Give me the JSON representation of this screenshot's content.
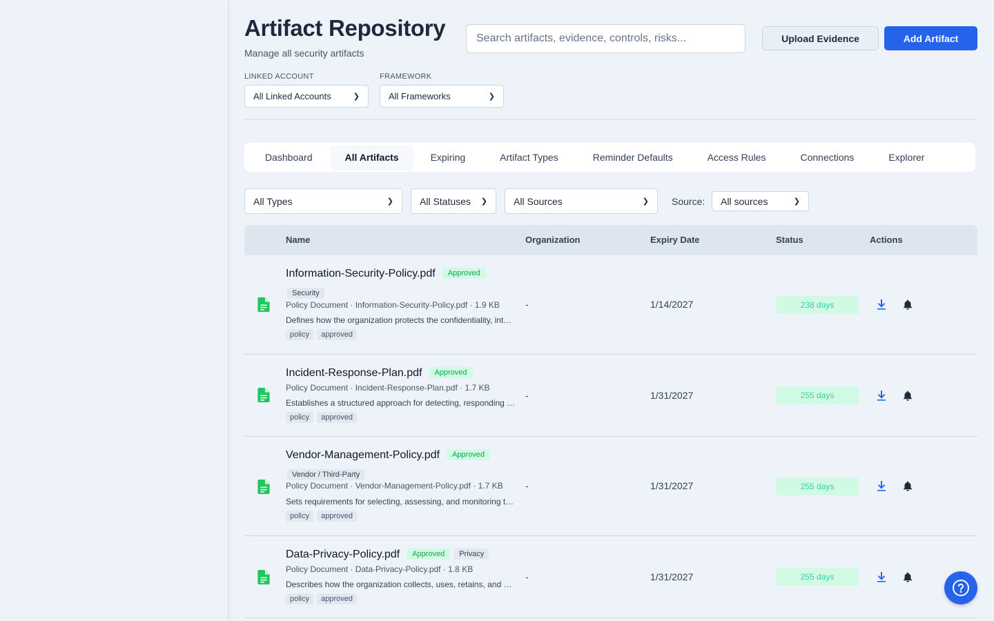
{
  "header": {
    "title": "Artifact Repository",
    "subtitle": "Manage all security artifacts"
  },
  "search": {
    "placeholder": "Search artifacts, evidence, controls, risks..."
  },
  "actions": {
    "upload_label": "Upload Evidence",
    "add_label": "Add Artifact"
  },
  "filters": {
    "linked_account_label": "LINKED ACCOUNT",
    "linked_account_value": "All Linked Accounts",
    "framework_label": "FRAMEWORK",
    "framework_value": "All Frameworks"
  },
  "tabs": [
    {
      "label": "Dashboard"
    },
    {
      "label": "All Artifacts",
      "active": true
    },
    {
      "label": "Expiring"
    },
    {
      "label": "Artifact Types"
    },
    {
      "label": "Reminder Defaults"
    },
    {
      "label": "Access Rules"
    },
    {
      "label": "Connections"
    },
    {
      "label": "Explorer"
    }
  ],
  "table_filters": {
    "type_value": "All Types",
    "status_value": "All Statuses",
    "sources_value": "All Sources",
    "source_label": "Source:",
    "source_value": "All sources"
  },
  "columns": {
    "name": "Name",
    "organization": "Organization",
    "expiry": "Expiry Date",
    "status": "Status",
    "actions": "Actions"
  },
  "rows": [
    {
      "name": "Information-Security-Policy.pdf",
      "approval": "Approved",
      "category": "Security",
      "meta": "Policy Document · Information-Security-Policy.pdf · 1.9 KB",
      "description": "Defines how the organization protects the confidentiality, integrity and availability of information.",
      "tags": [
        "policy",
        "approved"
      ],
      "organization": "-",
      "expiry": "1/14/2027",
      "status": "238 days"
    },
    {
      "name": "Incident-Response-Plan.pdf",
      "approval": "Approved",
      "category": "",
      "meta": "Policy Document · Incident-Response-Plan.pdf · 1.7 KB",
      "description": "Establishes a structured approach for detecting, responding to and recovering from incidents.",
      "tags": [
        "policy",
        "approved"
      ],
      "organization": "-",
      "expiry": "1/31/2027",
      "status": "255 days"
    },
    {
      "name": "Vendor-Management-Policy.pdf",
      "approval": "Approved",
      "category": "Vendor / Third-Party",
      "meta": "Policy Document · Vendor-Management-Policy.pdf · 1.7 KB",
      "description": "Sets requirements for selecting, assessing, and monitoring third-party vendors.",
      "tags": [
        "policy",
        "approved"
      ],
      "organization": "-",
      "expiry": "1/31/2027",
      "status": "255 days"
    },
    {
      "name": "Data-Privacy-Policy.pdf",
      "approval": "Approved",
      "category": "Privacy",
      "meta": "Policy Document · Data-Privacy-Policy.pdf · 1.8 KB",
      "description": "Describes how the organization collects, uses, retains, and discloses personal data.",
      "tags": [
        "policy",
        "approved"
      ],
      "organization": "-",
      "expiry": "1/31/2027",
      "status": "255 days"
    }
  ],
  "colors": {
    "primary": "#2563eb",
    "approved_bg": "#d1fae5",
    "approved_text": "#16a34a",
    "doc_icon": "#22c55e"
  },
  "icons": {
    "row_icon": "document-icon",
    "download": "download-icon",
    "reminder": "bell-icon",
    "help": "help-icon"
  }
}
